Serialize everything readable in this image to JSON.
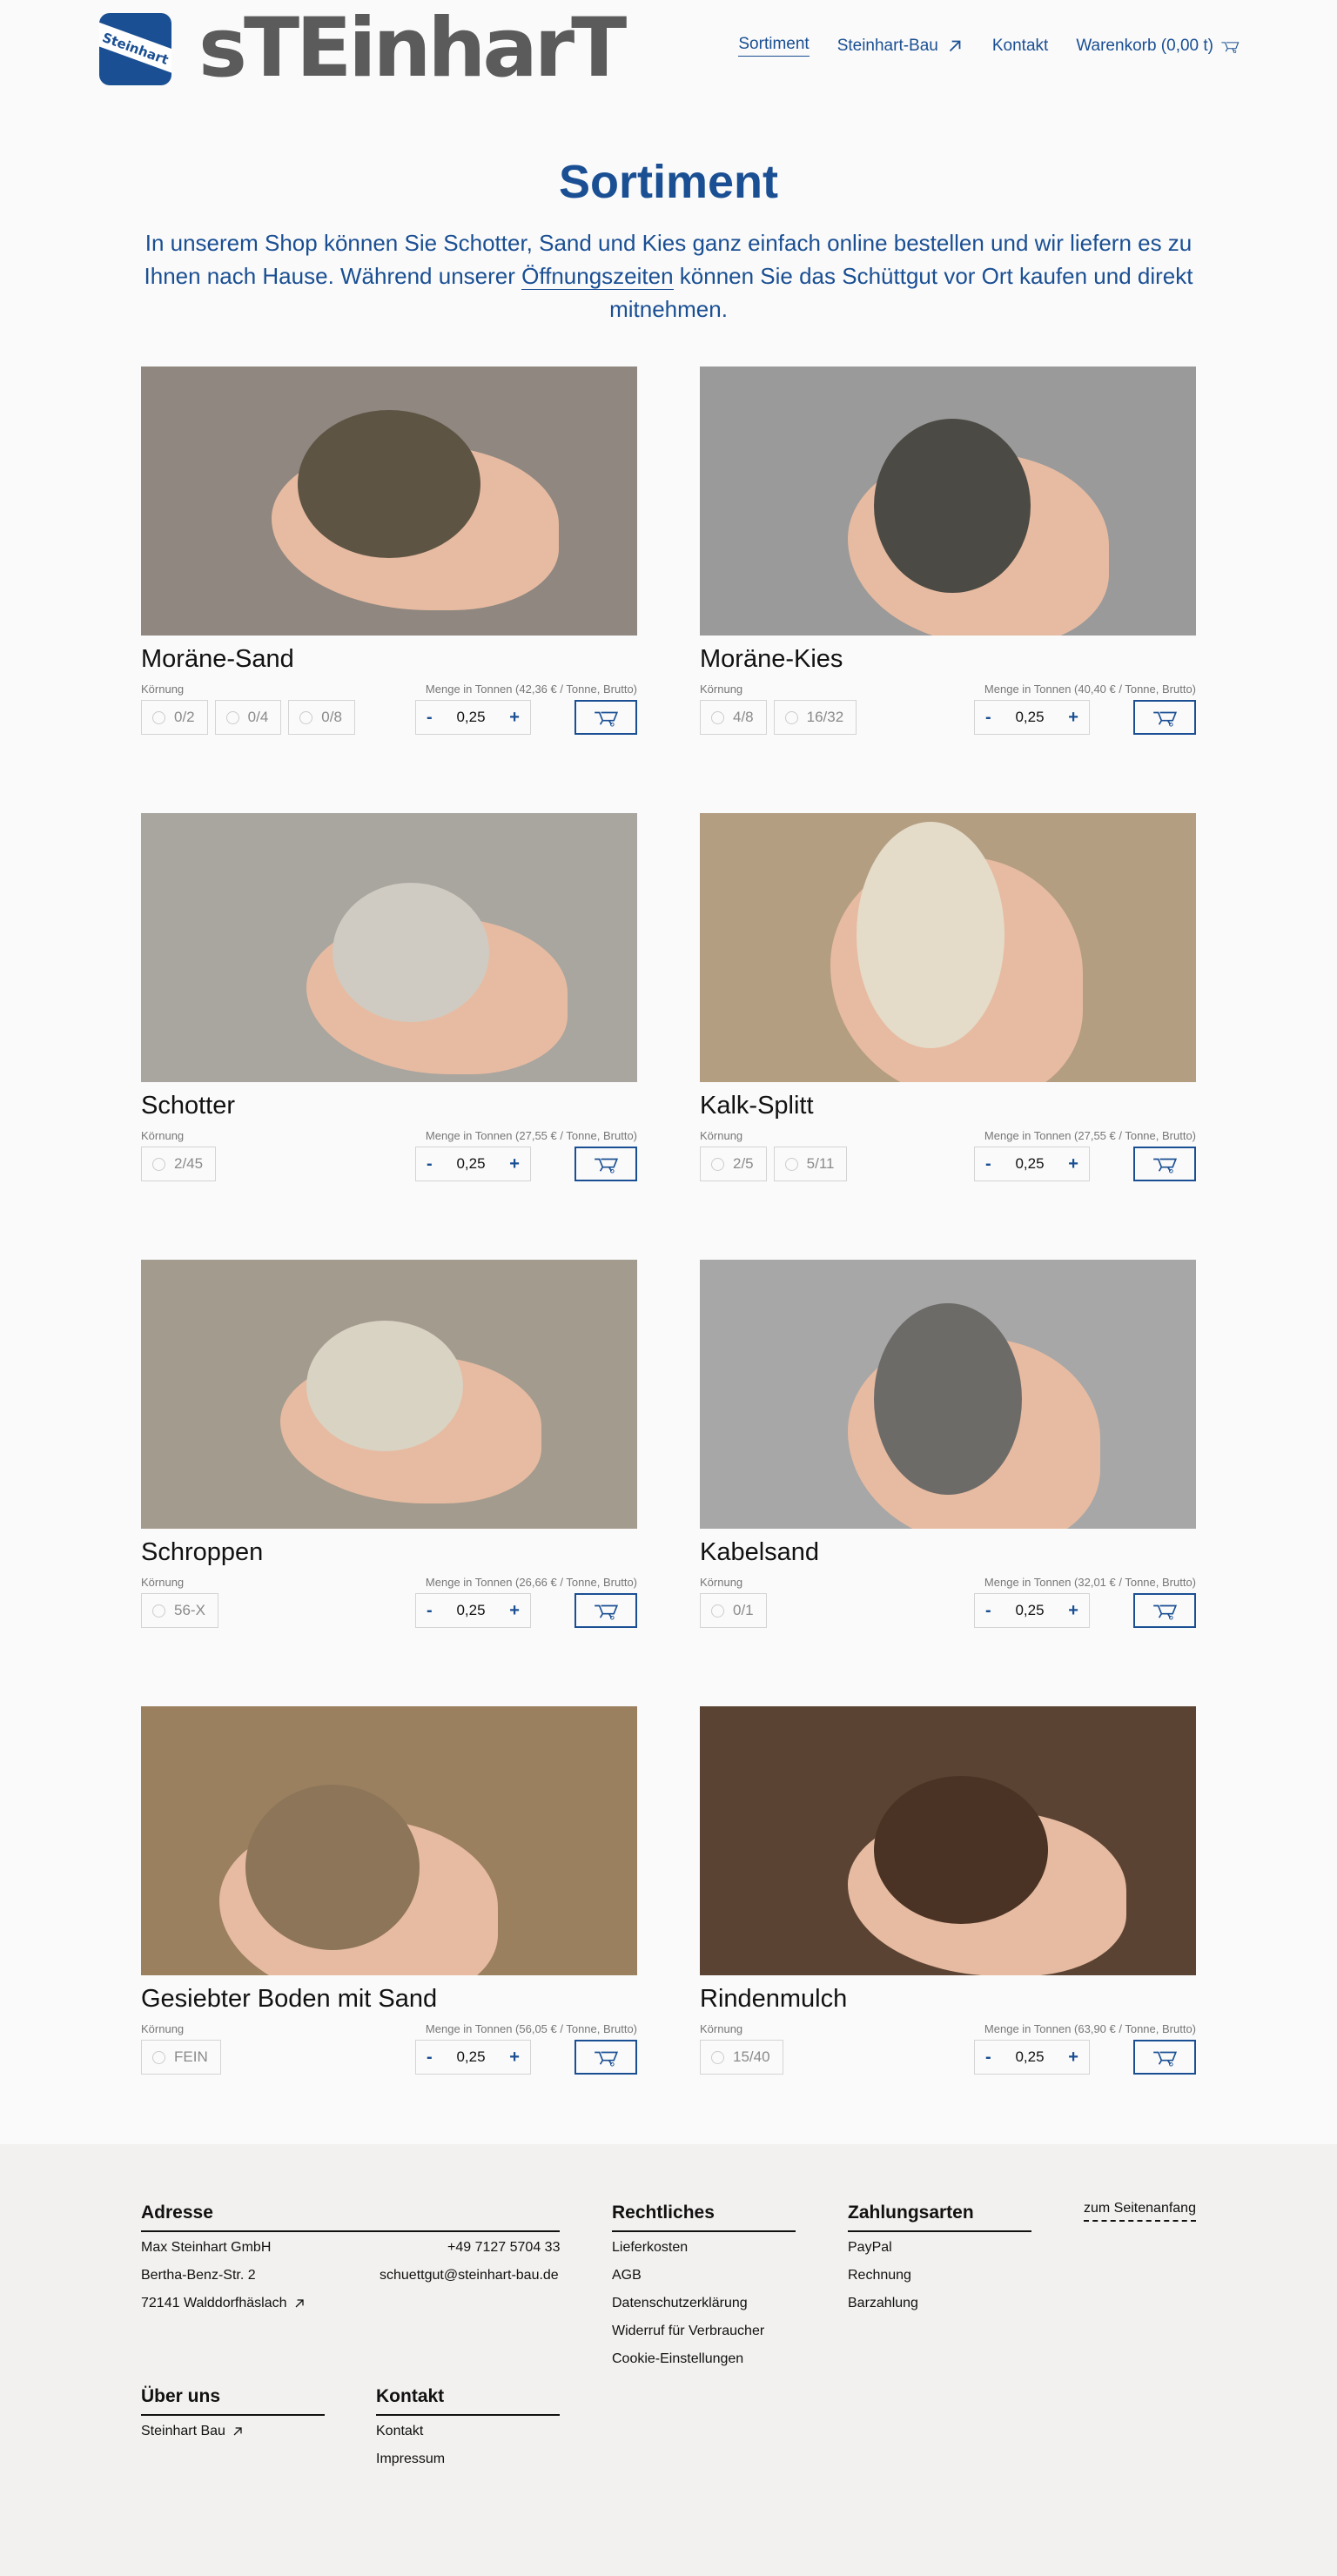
{
  "brand": {
    "badge_text": "Steinhart",
    "wordmark": "sTEinharT"
  },
  "nav": {
    "items": [
      {
        "label": "Sortiment"
      },
      {
        "label": "Steinhart-Bau"
      },
      {
        "label": "Kontakt"
      },
      {
        "label": "Warenkorb (0,00 t)"
      }
    ]
  },
  "page": {
    "title": "Sortiment",
    "intro_a": "In unserem Shop können Sie Schotter, Sand und Kies ganz einfach online bestellen und wir liefern es zu Ihnen nach Hause. Während unserer ",
    "intro_link": "Öffnungszeiten",
    "intro_b": " können Sie das Schüttgut vor Ort kaufen und direkt mitnehmen."
  },
  "common": {
    "grain_label": "Körnung",
    "minus": "-",
    "plus": "+"
  },
  "products": [
    {
      "name": "Moräne-Sand",
      "price_label": "Menge in Tonnen (42,36 € / Tonne, Brutto)",
      "options": [
        "0/2",
        "0/4",
        "0/8"
      ],
      "qty": "0,25"
    },
    {
      "name": "Moräne-Kies",
      "price_label": "Menge in Tonnen (40,40 € / Tonne, Brutto)",
      "options": [
        "4/8",
        "16/32"
      ],
      "qty": "0,25"
    },
    {
      "name": "Schotter",
      "price_label": "Menge in Tonnen (27,55 € / Tonne, Brutto)",
      "options": [
        "2/45"
      ],
      "qty": "0,25"
    },
    {
      "name": "Kalk-Splitt",
      "price_label": "Menge in Tonnen (27,55 € / Tonne, Brutto)",
      "options": [
        "2/5",
        "5/11"
      ],
      "qty": "0,25"
    },
    {
      "name": "Schroppen",
      "price_label": "Menge in Tonnen (26,66 € / Tonne, Brutto)",
      "options": [
        "56-X"
      ],
      "qty": "0,25"
    },
    {
      "name": "Kabelsand",
      "price_label": "Menge in Tonnen (32,01 € / Tonne, Brutto)",
      "options": [
        "0/1"
      ],
      "qty": "0,25"
    },
    {
      "name": "Gesiebter Boden mit Sand",
      "price_label": "Menge in Tonnen (56,05 € / Tonne, Brutto)",
      "options": [
        "FEIN"
      ],
      "qty": "0,25"
    },
    {
      "name": "Rindenmulch",
      "price_label": "Menge in Tonnen (63,90 € / Tonne, Brutto)",
      "options": [
        "15/40"
      ],
      "qty": "0,25"
    }
  ],
  "footer": {
    "address": {
      "title": "Adresse",
      "company": "Max Steinhart GmbH",
      "phone": "+49 7127 5704 33",
      "street": "Bertha-Benz-Str. 2",
      "email": "schuettgut@steinhart-bau.de",
      "city": "72141 Walddorfhäslach"
    },
    "legal": {
      "title": "Rechtliches",
      "items": [
        "Lieferkosten",
        "AGB",
        "Datenschutzerklärung",
        "Widerruf für Verbraucher",
        "Cookie-Einstellungen"
      ]
    },
    "payment": {
      "title": "Zahlungsarten",
      "items": [
        "PayPal",
        "Rechnung",
        "Barzahlung"
      ]
    },
    "about": {
      "title": "Über uns",
      "items": [
        "Steinhart Bau"
      ]
    },
    "contact": {
      "title": "Kontakt",
      "items": [
        "Kontakt",
        "Impressum"
      ]
    },
    "to_top": "zum Seitenanfang"
  }
}
